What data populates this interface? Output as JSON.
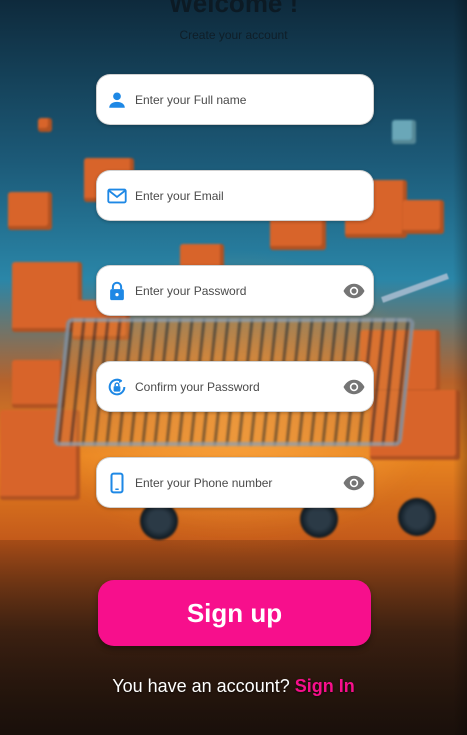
{
  "header": {
    "title": "Welcome !",
    "subtitle": "Create your account"
  },
  "form": {
    "full_name": {
      "placeholder": "Enter your Full name",
      "value": "",
      "icon": "person-icon"
    },
    "email": {
      "placeholder": "Enter your Email",
      "value": "",
      "icon": "mail-icon"
    },
    "password": {
      "placeholder": "Enter your Password",
      "value": "",
      "icon": "lock-icon",
      "toggle_icon": "eye-icon"
    },
    "confirm_password": {
      "placeholder": "Confirm your Password",
      "value": "",
      "icon": "lock-reset-icon",
      "toggle_icon": "eye-icon"
    },
    "phone": {
      "placeholder": "Enter your Phone number",
      "value": "",
      "icon": "phone-icon",
      "toggle_icon": "eye-icon"
    }
  },
  "actions": {
    "signup_label": "Sign up"
  },
  "footer": {
    "prompt": "You have an account?",
    "signin_label": "Sign In"
  },
  "colors": {
    "accent": "#f70f8c",
    "icon_blue": "#1e88e5",
    "eye_gray": "#757575",
    "field_bg": "#ffffff"
  }
}
